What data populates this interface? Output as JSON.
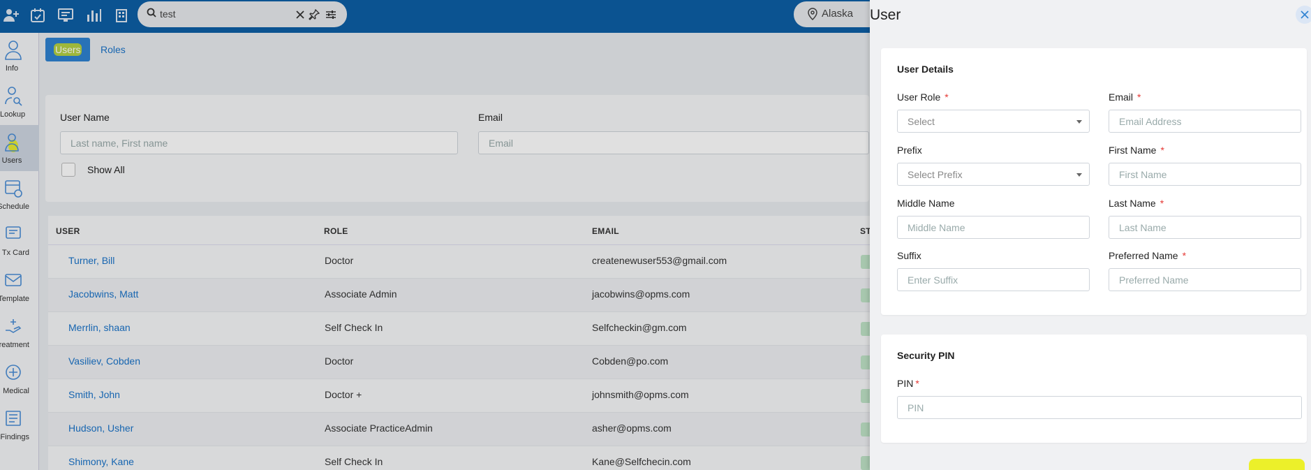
{
  "topbar": {
    "search": {
      "value": "test",
      "placeholder": ""
    },
    "location": "Alaska"
  },
  "sidebar": {
    "items": [
      {
        "label": "Info",
        "icon": "person-outline-icon"
      },
      {
        "label": "Lookup",
        "icon": "person-search-icon"
      },
      {
        "label": "Users",
        "icon": "users-icon"
      },
      {
        "label": "Schedule",
        "icon": "calendar-clock-icon"
      },
      {
        "label": "Tx Card",
        "icon": "card-icon"
      },
      {
        "label": "Template",
        "icon": "envelope-icon"
      },
      {
        "label": "Treatment",
        "icon": "hand-icon"
      },
      {
        "label": "Medical",
        "icon": "medical-icon"
      },
      {
        "label": "Findings",
        "icon": "report-icon"
      }
    ]
  },
  "main": {
    "tabs": {
      "users": "Users",
      "roles": "Roles"
    },
    "filters": {
      "user_name_label": "User Name",
      "user_name_placeholder": "Last name, First name",
      "email_label": "Email",
      "email_placeholder": "Email",
      "show_all_label": "Show All"
    },
    "table": {
      "headers": {
        "user": "USER",
        "role": "ROLE",
        "email": "EMAIL",
        "status": "ST"
      },
      "rows": [
        {
          "user": "Turner, Bill",
          "role": "Doctor",
          "email": "createnewuser553@gmail.com"
        },
        {
          "user": "Jacobwins, Matt",
          "role": "Associate Admin",
          "email": "jacobwins@opms.com"
        },
        {
          "user": "Merrlin, shaan",
          "role": "Self Check In",
          "email": "Selfcheckin@gm.com"
        },
        {
          "user": "Vasiliev, Cobden",
          "role": "Doctor",
          "email": "Cobden@po.com"
        },
        {
          "user": "Smith, John",
          "role": "Doctor +",
          "email": "johnsmith@opms.com"
        },
        {
          "user": "Hudson, Usher",
          "role": "Associate PracticeAdmin",
          "email": "asher@opms.com"
        },
        {
          "user": "Shimony, Kane",
          "role": "Self Check In",
          "email": "Kane@Selfchecin.com"
        }
      ]
    }
  },
  "panel": {
    "title": "User",
    "details": {
      "title": "User Details",
      "user_role_label": "User Role",
      "user_role_value": "Select",
      "email_label": "Email",
      "email_placeholder": "Email Address",
      "prefix_label": "Prefix",
      "prefix_value": "Select Prefix",
      "first_name_label": "First Name",
      "first_name_placeholder": "First Name",
      "middle_name_label": "Middle Name",
      "middle_name_placeholder": "Middle Name",
      "last_name_label": "Last Name",
      "last_name_placeholder": "Last Name",
      "suffix_label": "Suffix",
      "suffix_placeholder": "Enter Suffix",
      "preferred_name_label": "Preferred Name",
      "preferred_name_placeholder": "Preferred Name",
      "required_mark": "*"
    },
    "security": {
      "title": "Security PIN",
      "pin_label": "PIN",
      "pin_placeholder": "PIN"
    }
  },
  "colors": {
    "topbar": "#0d5fa6",
    "link": "#1a73c9",
    "active_tab": "#2e82d1",
    "required": "#e53935",
    "highlight": "#e1eb14"
  }
}
